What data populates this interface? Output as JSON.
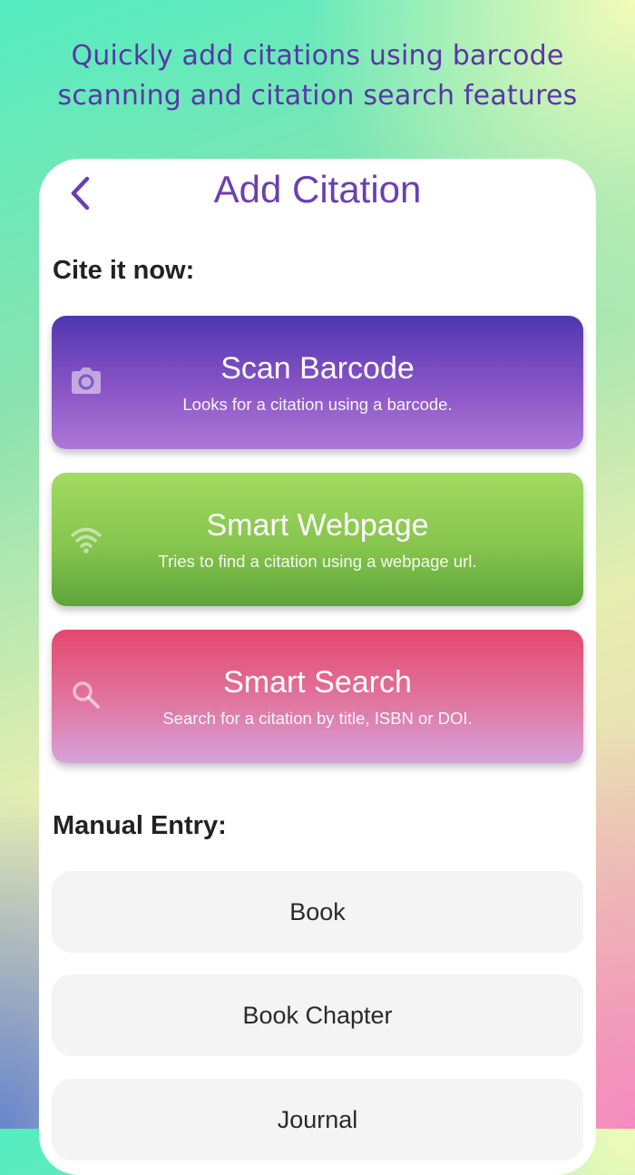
{
  "tagline": {
    "line1": "Quickly add citations using barcode",
    "line2": "scanning and citation search features"
  },
  "header": {
    "title": "Add Citation"
  },
  "cite_section": {
    "label": "Cite it now:",
    "cards": [
      {
        "title": "Scan Barcode",
        "subtitle": "Looks for a citation using a barcode.",
        "icon": "camera-icon",
        "color": "#6a45bd"
      },
      {
        "title": "Smart Webpage",
        "subtitle": "Tries to find a citation using a webpage url.",
        "icon": "wifi-icon",
        "color": "#86c54e"
      },
      {
        "title": "Smart Search",
        "subtitle": "Search for a citation by title, ISBN or DOI.",
        "icon": "search-icon",
        "color": "#e05a87"
      }
    ]
  },
  "manual_section": {
    "label": "Manual Entry:",
    "items": [
      "Book",
      "Book Chapter",
      "Journal"
    ]
  },
  "colors": {
    "accent": "#6b3fb0",
    "tagline": "#5b36a8"
  }
}
